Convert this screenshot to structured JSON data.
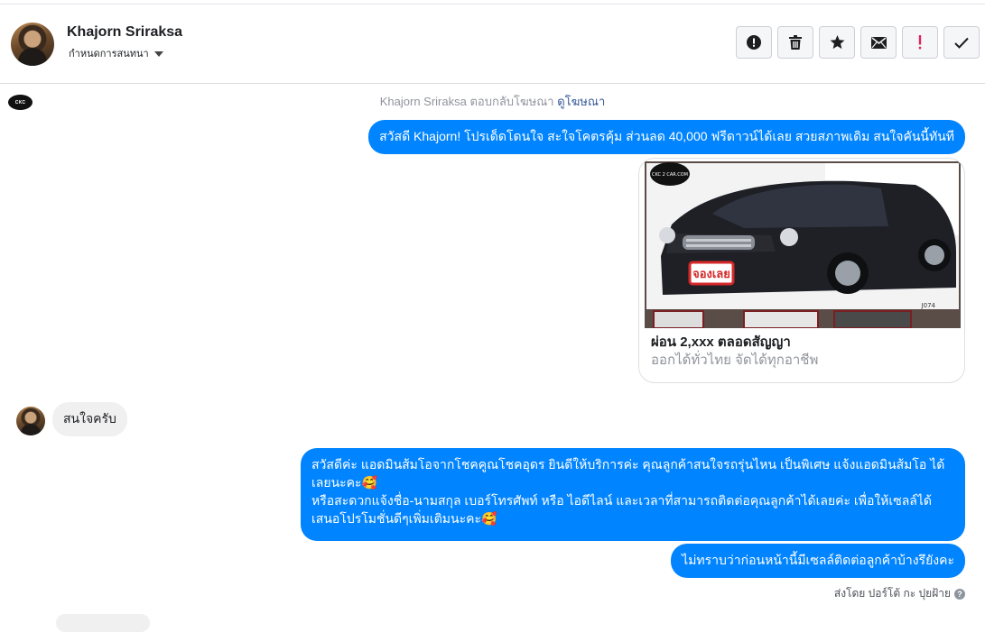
{
  "header": {
    "name": "Khajorn Sriraksa",
    "assign_label": "กำหนดการสนทนา",
    "actions": [
      {
        "name": "mark-spam-button",
        "icon": "exclamation-circle-icon"
      },
      {
        "name": "delete-button",
        "icon": "trash-icon"
      },
      {
        "name": "star-button",
        "icon": "star-icon"
      },
      {
        "name": "mark-unread-button",
        "icon": "envelope-icon"
      },
      {
        "name": "follow-up-button",
        "icon": "exclamation-icon"
      },
      {
        "name": "mark-done-button",
        "icon": "check-icon"
      }
    ]
  },
  "thread": {
    "page_logo_text": "CKC",
    "reply_note": "Khajorn Sriraksa ตอบกลับโฆษณา",
    "reply_link": "ดูโฆษณา",
    "msg1": "สวัสดี Khajorn! โปรเด็ดโดนใจ สะใจโคตรคุ้ม ส่วนลด 40,000 ฟรีดาวน์ได้เลย สวยสภาพเดิม สนใจคันนี้ทันที",
    "card": {
      "title": "ผ่อน 2,xxx ตลอดสัญญา",
      "subtitle": "ออกได้ทั่วไทย จัดได้ทุกอาชีพ",
      "watermark": "CKC 2 CAR.COM",
      "sticker": "จองเลย",
      "plate": "J074"
    },
    "incoming": "สนใจครับ",
    "msg2_line1": "สวัสดีค่ะ แอดมินส้มโอจากโชคคูณโชคอุดร ยินดีให้บริการค่ะ   คุณลูกค้าสนใจรถรุ่นไหน เป็นพิเศษ แจ้งแอดมินส้มโอ ได้เลยนะคะ🥰",
    "msg2_line2": "หรือสะดวกแจ้งชื่อ-นามสกุล เบอร์โทรศัพท์ หรือ ไอดีไลน์ และเวลาที่สามารถติดต่อคุณลูกค้าได้เลยค่ะ เพื่อให้เซลล์ได้เสนอโปรโมชั่นดีๆเพิ่มเติมนะคะ🥰",
    "msg3": "ไม่ทราบว่าก่อนหน้านี้มีเซลล์ติดต่อลูกค้าบ้างรึยังคะ",
    "sent_by": "ส่งโดย ปอร์โต้ กะ ปุยฝ้าย",
    "help_icon_text": "?"
  },
  "colors": {
    "outgoing_bubble": "#0084ff",
    "incoming_bubble": "#f1f0f0",
    "follow_up_red": "#e0245e",
    "link": "#365899"
  }
}
